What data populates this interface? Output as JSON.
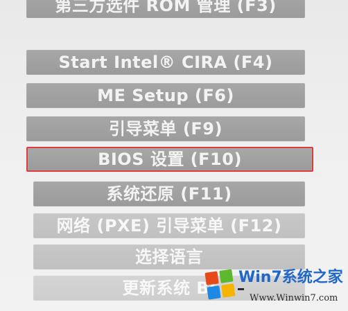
{
  "menu": {
    "items": [
      {
        "label": "第三方选件 ROM 管理 (F3)"
      },
      {
        "label": "Start Intel® CIRA (F4)"
      },
      {
        "label": "ME Setup (F6)"
      },
      {
        "label": "引导菜单 (F9)"
      },
      {
        "label": "BIOS 设置 (F10)"
      },
      {
        "label": "系统还原 (F11)"
      },
      {
        "label": "网络 (PXE) 引导菜单 (F12)"
      },
      {
        "label": "选择语言"
      },
      {
        "label": "更新系统 BI"
      }
    ],
    "selected_index": 4,
    "selection_color": "#e03b3b"
  },
  "watermark": {
    "title": "Win7系统之家",
    "url": "Www.Winwin7.com"
  }
}
